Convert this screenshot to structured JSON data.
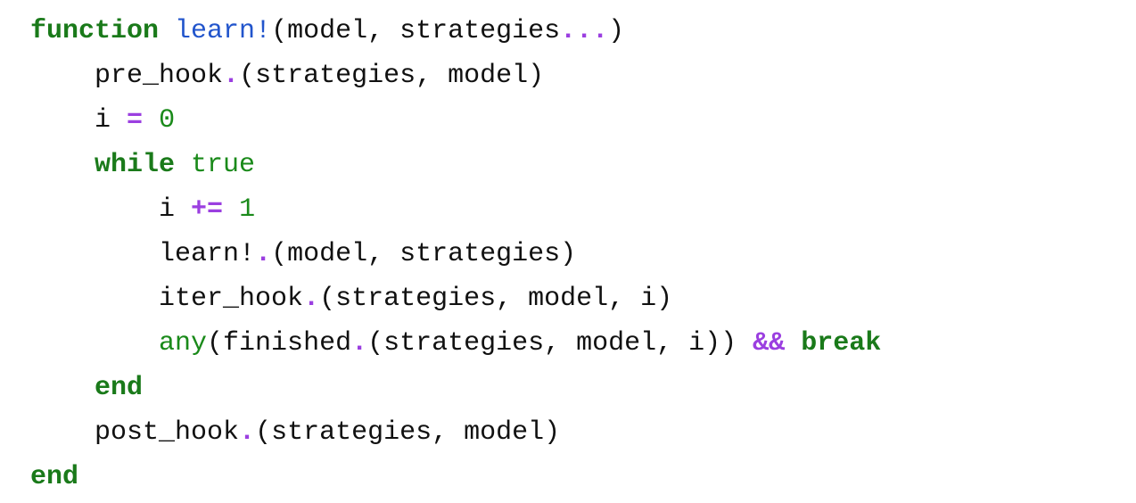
{
  "code": {
    "lines": [
      {
        "indent": "",
        "tokens": [
          {
            "t": "function",
            "k": "kw"
          },
          {
            "t": " ",
            "k": "plain"
          },
          {
            "t": "learn!",
            "k": "fn"
          },
          {
            "t": "(model, strategies",
            "k": "plain"
          },
          {
            "t": "...",
            "k": "op"
          },
          {
            "t": ")",
            "k": "plain"
          }
        ]
      },
      {
        "indent": "    ",
        "tokens": [
          {
            "t": "pre_hook",
            "k": "plain"
          },
          {
            "t": ".",
            "k": "op"
          },
          {
            "t": "(strategies, model)",
            "k": "plain"
          }
        ]
      },
      {
        "indent": "    ",
        "tokens": [
          {
            "t": "i ",
            "k": "plain"
          },
          {
            "t": "=",
            "k": "op"
          },
          {
            "t": " ",
            "k": "plain"
          },
          {
            "t": "0",
            "k": "lit"
          }
        ]
      },
      {
        "indent": "    ",
        "tokens": [
          {
            "t": "while",
            "k": "kw"
          },
          {
            "t": " ",
            "k": "plain"
          },
          {
            "t": "true",
            "k": "lit"
          }
        ]
      },
      {
        "indent": "        ",
        "tokens": [
          {
            "t": "i ",
            "k": "plain"
          },
          {
            "t": "+=",
            "k": "op"
          },
          {
            "t": " ",
            "k": "plain"
          },
          {
            "t": "1",
            "k": "lit"
          }
        ]
      },
      {
        "indent": "        ",
        "tokens": [
          {
            "t": "learn!",
            "k": "plain"
          },
          {
            "t": ".",
            "k": "op"
          },
          {
            "t": "(model, strategies)",
            "k": "plain"
          }
        ]
      },
      {
        "indent": "        ",
        "tokens": [
          {
            "t": "iter_hook",
            "k": "plain"
          },
          {
            "t": ".",
            "k": "op"
          },
          {
            "t": "(strategies, model, i)",
            "k": "plain"
          }
        ]
      },
      {
        "indent": "        ",
        "tokens": [
          {
            "t": "any",
            "k": "bi"
          },
          {
            "t": "(finished",
            "k": "plain"
          },
          {
            "t": ".",
            "k": "op"
          },
          {
            "t": "(strategies, model, i)) ",
            "k": "plain"
          },
          {
            "t": "&&",
            "k": "op"
          },
          {
            "t": " ",
            "k": "plain"
          },
          {
            "t": "break",
            "k": "kw"
          }
        ]
      },
      {
        "indent": "    ",
        "tokens": [
          {
            "t": "end",
            "k": "kw"
          }
        ]
      },
      {
        "indent": "    ",
        "tokens": [
          {
            "t": "post_hook",
            "k": "plain"
          },
          {
            "t": ".",
            "k": "op"
          },
          {
            "t": "(strategies, model)",
            "k": "plain"
          }
        ]
      },
      {
        "indent": "",
        "tokens": [
          {
            "t": "end",
            "k": "kw"
          }
        ]
      }
    ],
    "colors": {
      "keyword": "#1a7a1a",
      "function_name": "#2255cc",
      "operator": "#9b3fe0",
      "literal": "#1a8a1a",
      "text": "#111111"
    }
  }
}
